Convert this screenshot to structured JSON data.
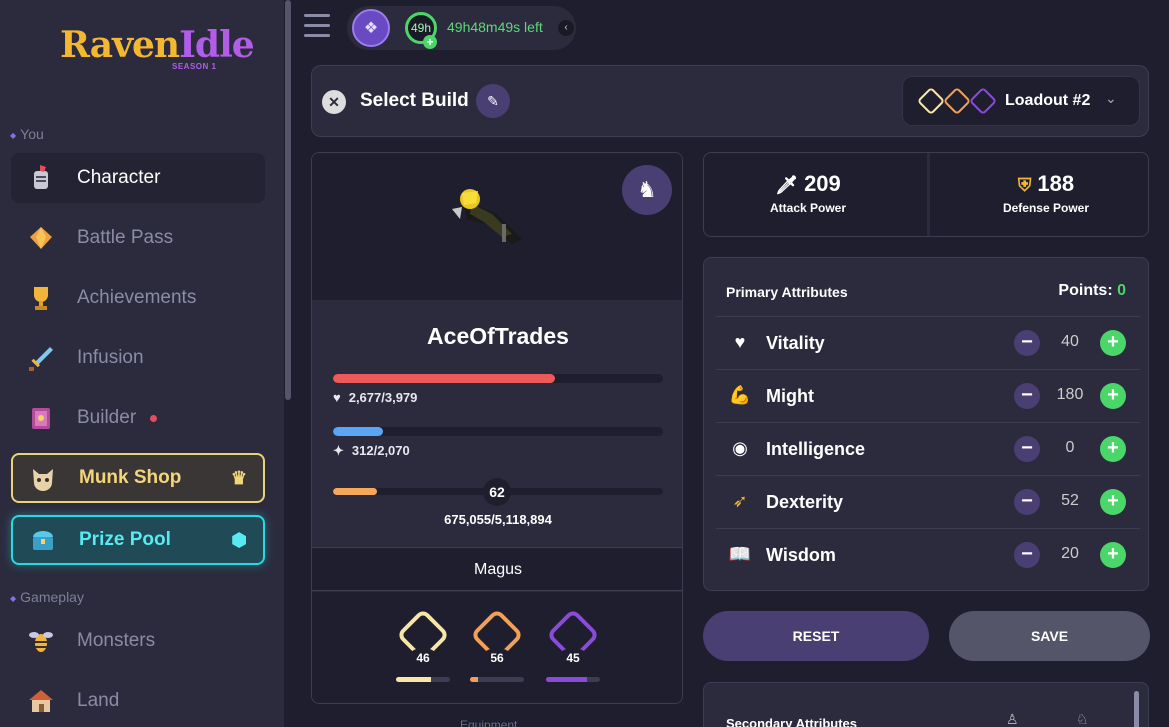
{
  "app": {
    "logo_raven": "Raven",
    "logo_idle": "Idle",
    "logo_season": "SEASON 1"
  },
  "sidebar": {
    "section_you": "You",
    "section_gameplay": "Gameplay",
    "items": [
      {
        "label": "Character",
        "icon": "knight-helmet-icon",
        "active": true
      },
      {
        "label": "Battle Pass",
        "icon": "gem-icon"
      },
      {
        "label": "Achievements",
        "icon": "trophy-icon"
      },
      {
        "label": "Infusion",
        "icon": "sword-icon"
      },
      {
        "label": "Builder",
        "icon": "spellbook-icon",
        "notification": true
      },
      {
        "label": "Munk Shop",
        "icon": "cat-icon",
        "trailing_icon": "crown-icon"
      },
      {
        "label": "Prize Pool",
        "icon": "treasure-icon",
        "trailing_icon": "hexagon-gem-icon"
      },
      {
        "label": "Monsters",
        "icon": "wasp-icon"
      },
      {
        "label": "Land",
        "icon": "house-icon"
      }
    ]
  },
  "topbar": {
    "level": "49h",
    "timer_text": "49h48m49s left",
    "collapse_symbol": "‹"
  },
  "build": {
    "title": "Select Build",
    "loadout_label": "Loadout #2"
  },
  "character": {
    "name": "AceOfTrades",
    "hp_text": "2,677/3,979",
    "hp_fraction": 0.673,
    "mana_text": "312/2,070",
    "mana_fraction": 0.151,
    "level": "62",
    "xp_text": "675,055/5,118,894",
    "xp_fraction": 0.132,
    "class_name": "Magus",
    "skills": [
      {
        "level": "46",
        "color": "#f6e7a8",
        "fraction": 0.65
      },
      {
        "level": "56",
        "color": "#f0a058",
        "fraction": 0.15
      },
      {
        "level": "45",
        "color": "#8a4bd8",
        "fraction": 0.75
      }
    ]
  },
  "power": {
    "attack_value": "209",
    "attack_label": "Attack Power",
    "defense_value": "188",
    "defense_label": "Defense Power"
  },
  "attributes": {
    "title": "Primary Attributes",
    "points_label": "Points:",
    "points_value": "0",
    "rows": [
      {
        "name": "Vitality",
        "value": "40",
        "icon": "heart-icon"
      },
      {
        "name": "Might",
        "value": "180",
        "icon": "flexed-arm-icon"
      },
      {
        "name": "Intelligence",
        "value": "0",
        "icon": "eye-icon"
      },
      {
        "name": "Dexterity",
        "value": "52",
        "icon": "wing-icon"
      },
      {
        "name": "Wisdom",
        "value": "20",
        "icon": "open-book-icon"
      }
    ]
  },
  "actions": {
    "reset_label": "RESET",
    "save_label": "SAVE"
  },
  "secondary": {
    "title": "Secondary Attributes"
  },
  "equipment": {
    "label": "Equipment"
  },
  "colors": {
    "bg": "#1e1e2e",
    "panel": "#2b2b3d",
    "accent_purple": "#4a3f72",
    "green": "#4bd66a",
    "hp_red": "#ee5a5a",
    "mana_blue": "#5aa6f5",
    "xp_orange": "#f5a85a"
  }
}
